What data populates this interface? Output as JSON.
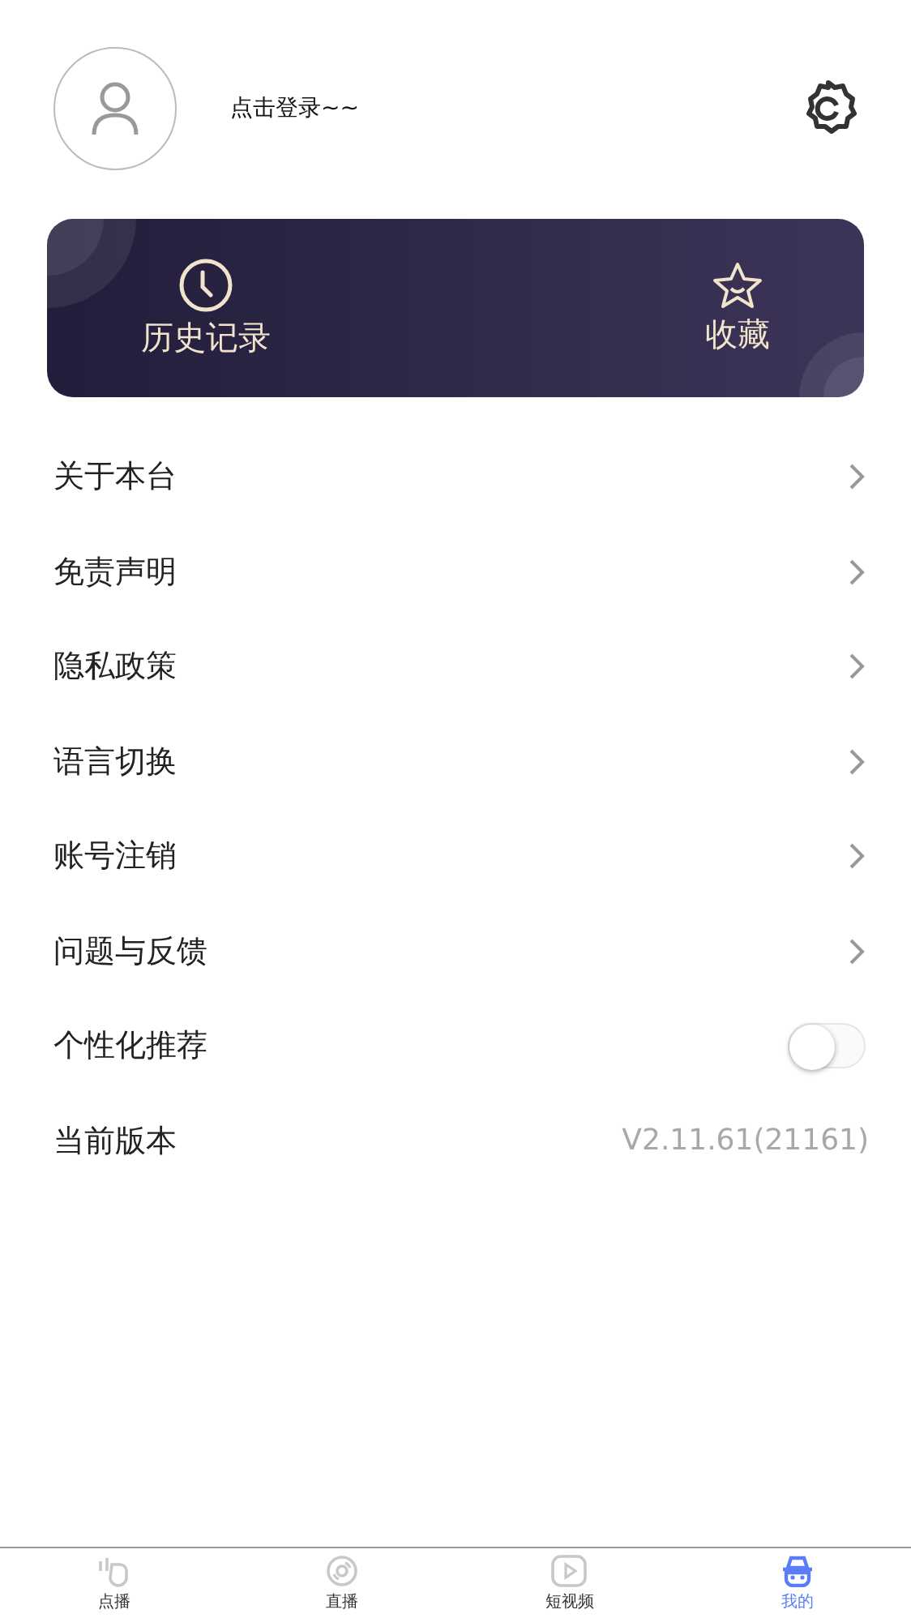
{
  "profile": {
    "login_prompt": "点击登录~~"
  },
  "shortcuts": [
    {
      "kind": "history",
      "label": "历史记录"
    },
    {
      "kind": "favorites",
      "label": "收藏"
    }
  ],
  "menu": [
    {
      "kind": "link",
      "label": "关于本台"
    },
    {
      "kind": "link",
      "label": "免责声明"
    },
    {
      "kind": "link",
      "label": "隐私政策"
    },
    {
      "kind": "link",
      "label": "语言切换"
    },
    {
      "kind": "link",
      "label": "账号注销"
    },
    {
      "kind": "link",
      "label": "问题与反馈"
    },
    {
      "kind": "toggle",
      "label": "个性化推荐",
      "on": false
    },
    {
      "kind": "version",
      "label": "当前版本",
      "value": "V2.11.61(21161)"
    }
  ],
  "tabs": [
    {
      "kind": "vod",
      "label": "点播",
      "selected": false
    },
    {
      "kind": "live",
      "label": "直播",
      "selected": false
    },
    {
      "kind": "short",
      "label": "短视频",
      "selected": false
    },
    {
      "kind": "mine",
      "label": "我的",
      "selected": true
    }
  ]
}
